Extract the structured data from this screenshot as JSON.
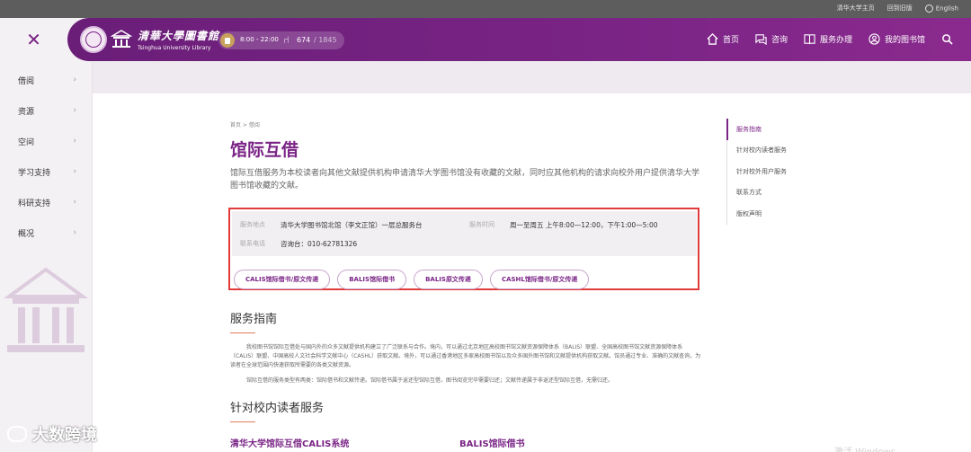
{
  "topbar": {
    "links": [
      "清华大学主页",
      "回到旧版",
      "English"
    ]
  },
  "header": {
    "logo_cn": "清華大學圖書館",
    "logo_en": "Tsinghua University Library",
    "hours": "8:00 - 22:00",
    "seats_occupied": "674",
    "seats_total": "/ 1845",
    "nav": [
      {
        "label": "首页",
        "icon": "home-icon"
      },
      {
        "label": "咨询",
        "icon": "chat-icon"
      },
      {
        "label": "服务办理",
        "icon": "book-icon"
      },
      {
        "label": "我的图书馆",
        "icon": "user-icon"
      }
    ]
  },
  "sidebar": {
    "close_icon": "✕",
    "items": [
      {
        "label": "借阅"
      },
      {
        "label": "资源"
      },
      {
        "label": "空间"
      },
      {
        "label": "学习支持"
      },
      {
        "label": "科研支持"
      },
      {
        "label": "概况"
      }
    ]
  },
  "content": {
    "breadcrumb": "首页 > 借阅",
    "title": "馆际互借",
    "intro": "馆际互借服务为本校读者向其他文献提供机构申请清华大学图书馆没有收藏的文献，同时应其他机构的请求向校外用户提供清华大学图书馆收藏的文献。",
    "info": {
      "location_label": "服务地点",
      "location_value": "清华大学图书馆北馆（李文正馆）一层总服务台",
      "time_label": "服务时间",
      "time_value": "周一至周五 上午8:00—12:00，下午1:00—5:00",
      "phone_label": "联系电话",
      "phone_value": "咨询台：010-62781326"
    },
    "buttons": [
      "CALIS馆际借书/原文传递",
      "BALIS馆际借书",
      "BALIS原文传递",
      "CASHL馆际借书/原文传递"
    ],
    "section1_title": "服务指南",
    "section1_p1": "我校图书馆馆际互借处与国内外的众多文献提供机构建立了广泛联系与合作。境内，可以通过北京地区高校图书馆文献资源保障体系（BALIS）联盟、全国高校图书馆文献资源保障体系（CALIS）联盟、中国高校人文社会科学文献中心（CASHL）获取文献。境外，可以通过香港地区多家高校图书馆以及众多国外图书馆和文献提供机构获取文献。馆员通过专业、准确的文献查询，为读者在全球范围内快速获取所需要的各类文献资源。",
    "section1_p2": "馆际互借的服务类型有两类：馆际借书和文献传递。馆际借书属于返还型馆际互借，图书阅览完毕需要归还；文献传递属于非返还型馆际互借，无需归还。",
    "section2_title": "针对校内读者服务",
    "sublinks": [
      "清华大学馆际互借CALIS系统",
      "BALIS馆际借书"
    ]
  },
  "toc": [
    "服务指南",
    "针对校内读者服务",
    "针对校外用户服务",
    "联系方式",
    "版权声明"
  ],
  "watermark": "大数跨境",
  "os_overlay": "激活 Windows",
  "colors": {
    "brand": "#7a2486",
    "accent_border": "#e23a3a"
  }
}
